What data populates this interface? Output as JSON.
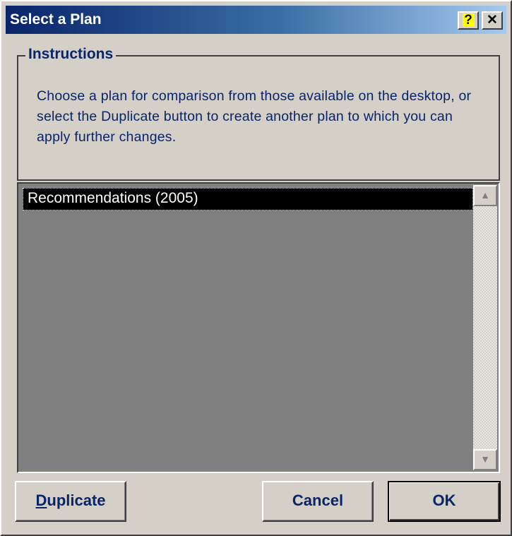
{
  "window": {
    "title": "Select a Plan",
    "help_label": "?",
    "close_label": "✕"
  },
  "instructions": {
    "legend": "Instructions",
    "text": "Choose a plan for comparison from those available on the desktop, or select the Duplicate button to create another plan to which you can apply further changes."
  },
  "plans": {
    "items": [
      {
        "label": "Recommendations (2005)",
        "selected": true
      }
    ]
  },
  "scrollbar": {
    "up_icon": "▲",
    "down_icon": "▼"
  },
  "buttons": {
    "duplicate_access_key": "D",
    "duplicate_rest": "uplicate",
    "cancel": "Cancel",
    "ok": "OK"
  },
  "colors": {
    "title_gradient_start": "#0a246a",
    "title_gradient_end": "#a6caf0",
    "face": "#d4d0c8",
    "list_bg": "#808080",
    "selection": "#000000",
    "text_accent": "#0a246a"
  }
}
